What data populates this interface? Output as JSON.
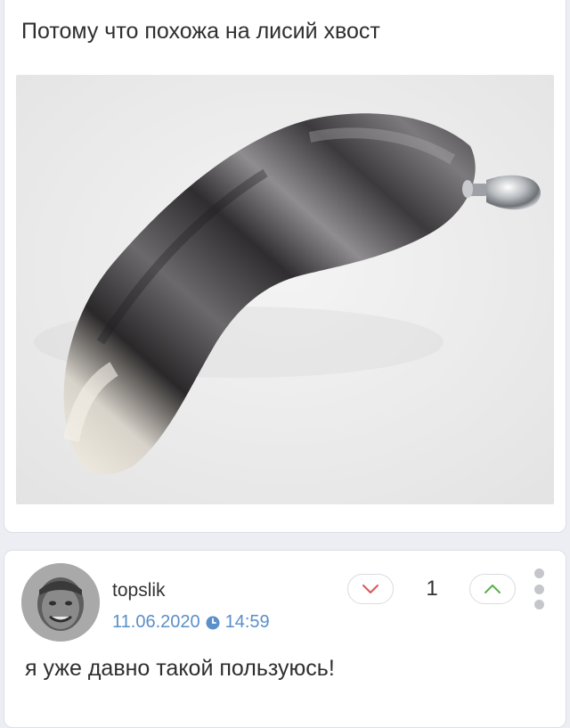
{
  "post": {
    "text": "Потому что похожа на лисий хвост",
    "image_subject": "fox tail plug photo"
  },
  "comment": {
    "username": "topslik",
    "date": "11.06.2020",
    "time": "14:59",
    "score": "1",
    "text": "я уже давно такой пользуюсь!"
  },
  "icons": {
    "vote_down": "chevron-down-icon",
    "vote_up": "chevron-up-icon",
    "clock": "clock-icon",
    "menu": "more-vertical-icon"
  },
  "colors": {
    "link_blue": "#5b8fc9",
    "downvote_red": "#e05555",
    "upvote_green": "#5fae4f",
    "background": "#eceef3"
  }
}
